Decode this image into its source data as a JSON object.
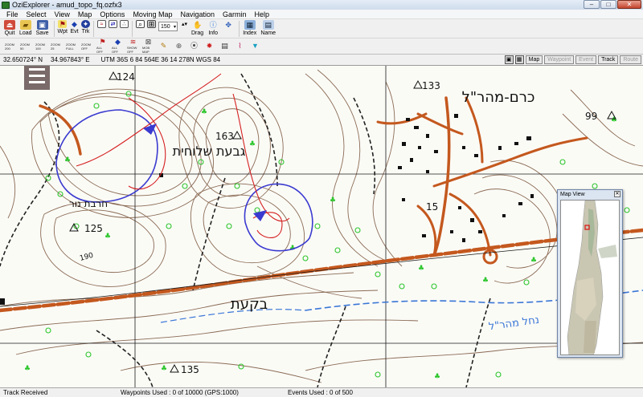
{
  "window": {
    "title": "OziExplorer - amud_topo_fq.ozfx3"
  },
  "menu": [
    "File",
    "Select",
    "View",
    "Map",
    "Options",
    "Moving Map",
    "Navigation",
    "Garmin",
    "Help"
  ],
  "toolbar1": {
    "quit": "Quit",
    "load": "Load",
    "save": "Save",
    "wpt": "Wpt",
    "evt": "Evt",
    "trk": "Trk",
    "zoom_level": "150",
    "drag": "Drag",
    "info": "Info",
    "index": "Index",
    "name": "Name"
  },
  "toolbar2": {
    "zoom_labels": [
      "ZOOM 200",
      "ZOOM 50",
      "ZOOM 100",
      "ZOOM 25",
      "ZOOM FULL",
      "ZOOM OFF",
      "ALL OFF",
      "ALL OFF",
      "SHOW OFF",
      "MOB MAP"
    ]
  },
  "coords": {
    "lat": "32.650724° N",
    "lon": "34.967843° E",
    "utm": "UTM  36S    6 84 564E    36 14 278N  WGS 84"
  },
  "modes": {
    "map": "Map",
    "waypoint": "Waypoint",
    "event": "Event",
    "track": "Track",
    "route": "Route"
  },
  "map_labels": {
    "kerem": "כרם-מהר\"ל",
    "givat": "גבעת שלוחית",
    "hirbet": "חרבת נור",
    "bikat": "בקעת",
    "nahal": "נחל מהר\"ל",
    "h124": "124",
    "h163": "163",
    "h133": "133",
    "h125": "125",
    "h135": "135",
    "h99": "99",
    "h15": "15",
    "h190": "190"
  },
  "mapview": {
    "title": "Map View"
  },
  "status": {
    "left": "Track Received",
    "waypoints": "Waypoints Used : 0 of 10000  (GPS:1000)",
    "events": "Events Used : 0 of 500"
  },
  "colors": {
    "road": "#c4581e",
    "track": "#3a3ad0",
    "route": "#d42020",
    "forest": "#2cc62c",
    "contour": "#8a6b55",
    "stream": "#3a76d6"
  }
}
